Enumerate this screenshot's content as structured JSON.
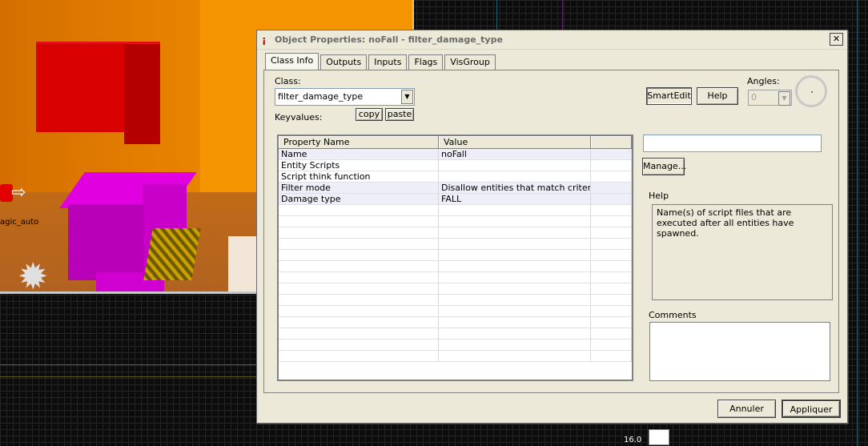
{
  "viewport": {
    "entity_label": "agic_auto",
    "grid_readout": "16.0"
  },
  "dialog": {
    "title": "Object Properties: noFall - filter_damage_type",
    "close_label": "✕",
    "tabs": [
      {
        "label": "Class Info",
        "active": true
      },
      {
        "label": "Outputs",
        "active": false
      },
      {
        "label": "Inputs",
        "active": false
      },
      {
        "label": "Flags",
        "active": false
      },
      {
        "label": "VisGroup",
        "active": false
      }
    ],
    "class_label": "Class:",
    "class_value": "filter_damage_type",
    "keyvalues_label": "Keyvalues:",
    "copy_label": "copy",
    "paste_label": "paste",
    "smartedit_label": "SmartEdit",
    "help_button_label": "Help",
    "angles_label": "Angles:",
    "angles_value": "0",
    "table": {
      "headers": [
        "Property Name",
        "Value"
      ],
      "rows": [
        {
          "name": "Name",
          "value": "noFall"
        },
        {
          "name": "Entity Scripts",
          "value": ""
        },
        {
          "name": "Script think function",
          "value": ""
        },
        {
          "name": "Filter mode",
          "value": "Disallow entities that match criteria"
        },
        {
          "name": "Damage type",
          "value": "FALL"
        }
      ]
    },
    "value_field": "",
    "manage_label": "Manage...",
    "help_group_label": "Help",
    "help_text": "Name(s) of script files that are executed after all entities have spawned.",
    "comments_label": "Comments",
    "comments_value": "",
    "cancel_label": "Annuler",
    "apply_label": "Appliquer"
  }
}
